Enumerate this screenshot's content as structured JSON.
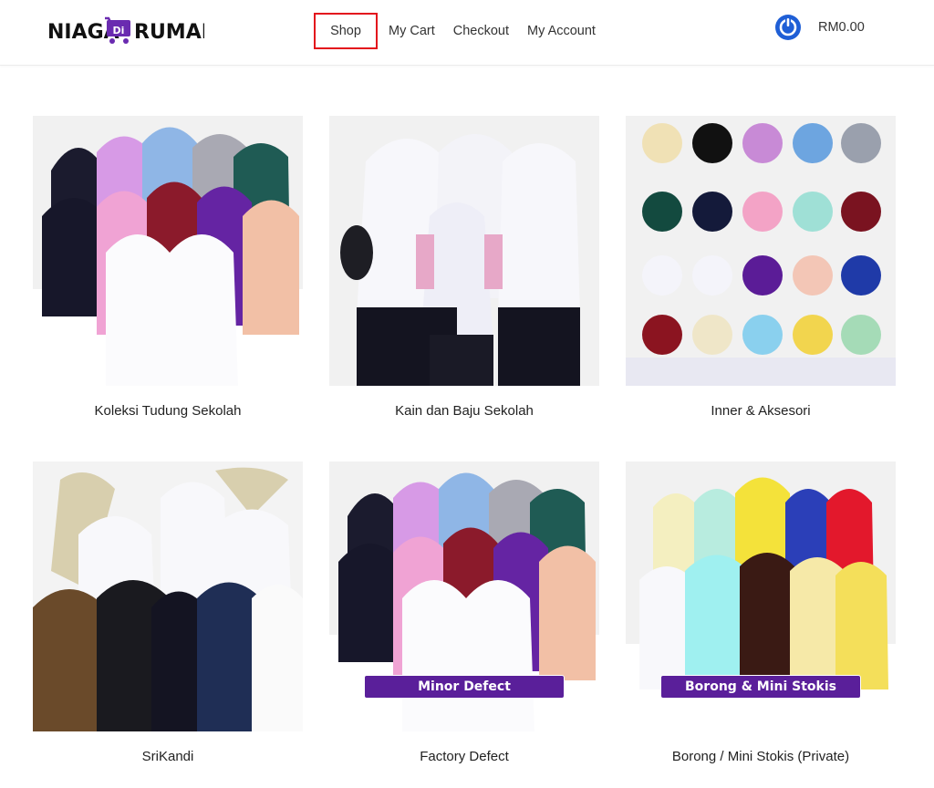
{
  "header": {
    "logo_text_left": "NIAGA",
    "logo_text_mid": "Di",
    "logo_text_right": "RUMAH",
    "nav": [
      {
        "label": "Shop",
        "active": true
      },
      {
        "label": "My Cart"
      },
      {
        "label": "Checkout"
      },
      {
        "label": "My Account"
      }
    ],
    "cart_total": "RM0.00"
  },
  "categories": [
    {
      "label": "Koleksi Tudung Sekolah",
      "banner": ""
    },
    {
      "label": "Kain dan Baju Sekolah",
      "banner": ""
    },
    {
      "label": "Inner & Aksesori",
      "banner": ""
    },
    {
      "label": "SriKandi",
      "banner": ""
    },
    {
      "label": "Factory Defect",
      "banner": "Minor Defect"
    },
    {
      "label": "Borong / Mini Stokis (Private)",
      "banner": "Borong & Mini Stokis"
    }
  ],
  "colors": {
    "brand_purple": "#5a1f9a",
    "accent_blue": "#1f5fd6",
    "active_border": "#e3121c"
  }
}
